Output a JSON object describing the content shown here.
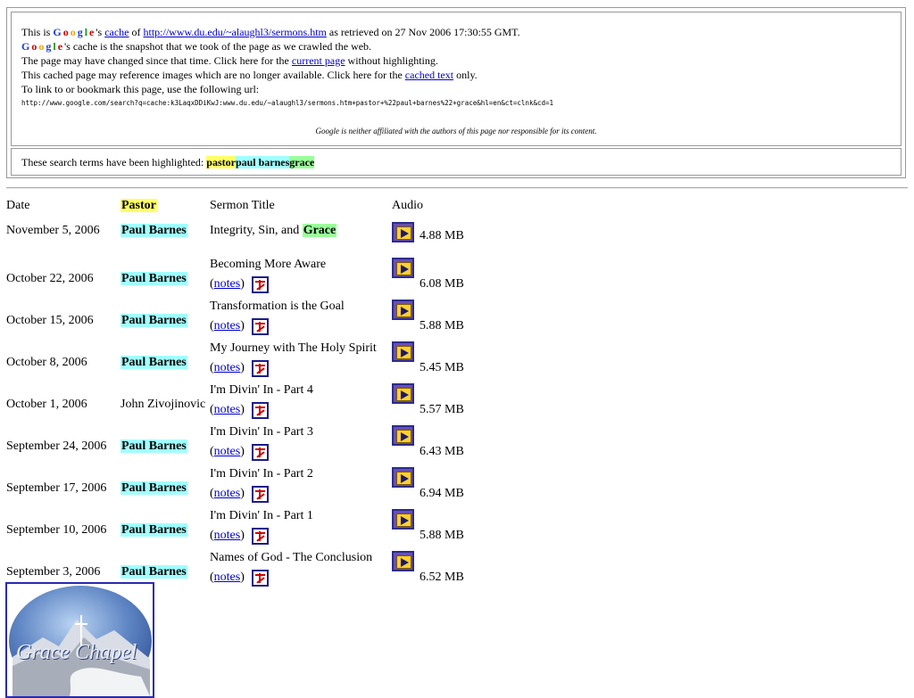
{
  "cache": {
    "line1": {
      "prefix": "This is ",
      "logo": [
        "G",
        "o",
        "o",
        "g",
        "l",
        "e"
      ],
      "after_logo": "'s ",
      "cache_link": "cache",
      "of": " of ",
      "url_link": "http://www.du.edu/~alaughl3/sermons.htm",
      "suffix": " as retrieved on 27 Nov 2006 17:30:55 GMT."
    },
    "line2": "'s cache is the snapshot that we took of the page as we crawled the web.",
    "line3": {
      "prefix": "The page may have changed since that time. Click here for the ",
      "link": "current page",
      "suffix": " without highlighting."
    },
    "line4": {
      "prefix": "This cached page may reference images which are no longer available. Click here for the ",
      "link": "cached text",
      "suffix": " only."
    },
    "line5": "To link to or bookmark this page, use the following url:",
    "bookmark_url": "http://www.google.com/search?q=cache:k3LaqxDDiKwJ:www.du.edu/~alaughl3/sermons.htm+pastor+%22paul+barnes%22+grace&hl=en&ct=clnk&cd=1",
    "disclaimer": "Google is neither affiliated with the authors of this page nor responsible for its content.",
    "highlight_label": "These search terms have been highlighted: ",
    "terms": [
      "pastor",
      "paul barnes",
      "grace"
    ],
    "colors": {
      "pastor": "#ffff66",
      "paul_barnes": "#a0ffff",
      "grace": "#99ff99"
    }
  },
  "table": {
    "headers": {
      "date": "Date",
      "pastor": "Pastor",
      "title": "Sermon Title",
      "audio": "Audio"
    },
    "notes_open": "(",
    "notes_link": "notes",
    "notes_close": ")",
    "rows": [
      {
        "date": "November 5, 2006",
        "pastor": "Paul Barnes",
        "title": "Integrity, Sin, and ",
        "title_hl": "Grace",
        "notes": false,
        "size": "4.88 MB"
      },
      {
        "date": "October 22, 2006",
        "pastor": "Paul Barnes",
        "title": "Becoming More Aware",
        "title_hl": "",
        "notes": true,
        "size": "6.08 MB"
      },
      {
        "date": "October 15, 2006",
        "pastor": "Paul Barnes",
        "title": "Transformation is the Goal",
        "title_hl": "",
        "notes": true,
        "size": "5.88 MB"
      },
      {
        "date": "October 8, 2006",
        "pastor": "Paul Barnes",
        "title": "My Journey with The Holy Spirit",
        "title_hl": "",
        "notes": true,
        "size": "5.45 MB"
      },
      {
        "date": "October 1, 2006",
        "pastor": "John Zivojinovic",
        "title": "I'm Divin' In - Part 4",
        "title_hl": "",
        "notes": true,
        "size": "5.57 MB"
      },
      {
        "date": "September 24, 2006",
        "pastor": "Paul Barnes",
        "title": "I'm Divin' In - Part 3",
        "title_hl": "",
        "notes": true,
        "size": "6.43 MB"
      },
      {
        "date": "September 17, 2006",
        "pastor": "Paul Barnes",
        "title": "I'm Divin' In - Part 2",
        "title_hl": "",
        "notes": true,
        "size": "6.94 MB"
      },
      {
        "date": "September 10, 2006",
        "pastor": "Paul Barnes",
        "title": "I'm Divin' In - Part 1",
        "title_hl": "",
        "notes": true,
        "size": "5.88 MB"
      },
      {
        "date": "September 3, 2006",
        "pastor": "Paul Barnes",
        "title": "Names of God - The Conclusion",
        "title_hl": "",
        "notes": true,
        "size": "6.52 MB"
      }
    ]
  },
  "logo": {
    "text": "Grace Chapel",
    "icon": "grace-chapel-logo"
  }
}
